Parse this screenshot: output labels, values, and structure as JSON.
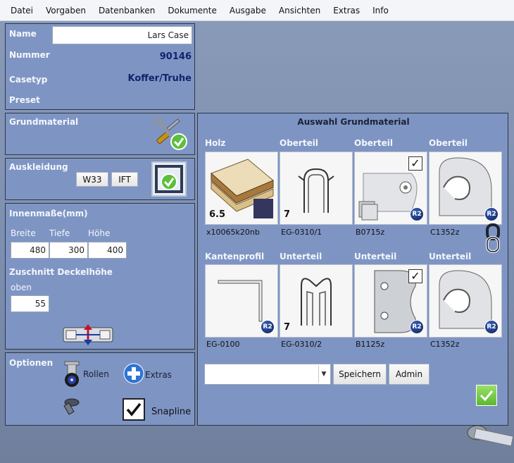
{
  "menu": [
    "Datei",
    "Vorgaben",
    "Datenbanken",
    "Dokumente",
    "Ausgabe",
    "Ansichten",
    "Extras",
    "Info"
  ],
  "case": {
    "name_label": "Name",
    "name_value": "Lars Case",
    "nummer_label": "Nummer",
    "nummer_value": "90146",
    "casetyp_label": "Casetyp",
    "casetyp_value": "Koffer/Truhe",
    "preset_label": "Preset"
  },
  "grundmaterial": {
    "title": "Grundmaterial"
  },
  "auskleidung": {
    "title": "Auskleidung",
    "btn_w33": "W33",
    "btn_ift": "IFT"
  },
  "innenmasse": {
    "title": "Innenmaße(mm)",
    "breite_label": "Breite",
    "tiefe_label": "Tiefe",
    "hoehe_label": "Höhe",
    "breite": "480",
    "tiefe": "300",
    "hoehe": "400",
    "zuschnitt_title": "Zuschnitt Deckelhöhe",
    "oben_label": "oben",
    "oben": "55"
  },
  "optionen": {
    "title": "Optionen",
    "rollen": "Rollen",
    "extras": "Extras",
    "snapline": "Snapline",
    "snapline_checked": true
  },
  "auswahl": {
    "title": "Auswahl Grundmaterial",
    "row1": [
      {
        "title": "Holz",
        "caption": "x10065k20nb",
        "num": "6.5"
      },
      {
        "title": "Oberteil",
        "caption": "EG-0310/1",
        "num": "7"
      },
      {
        "title": "Oberteil",
        "caption": "B0715z",
        "badge": "R2",
        "checked": true
      },
      {
        "title": "Oberteil",
        "caption": "C1352z",
        "badge": "R2"
      }
    ],
    "row2": [
      {
        "title": "Kantenprofil",
        "caption": "EG-0100",
        "badge": "R2"
      },
      {
        "title": "Unterteil",
        "caption": "EG-0310/2",
        "num": "7"
      },
      {
        "title": "Unterteil",
        "caption": "B1125z",
        "badge": "R2",
        "checked": true
      },
      {
        "title": "Unterteil",
        "caption": "C1352z",
        "badge": "R2"
      }
    ],
    "select_value": "",
    "save_label": "Speichern",
    "admin_label": "Admin"
  },
  "colors": {
    "panel": "#7e95c4",
    "value_text": "#12236a",
    "accept_green": "#7ac943"
  }
}
